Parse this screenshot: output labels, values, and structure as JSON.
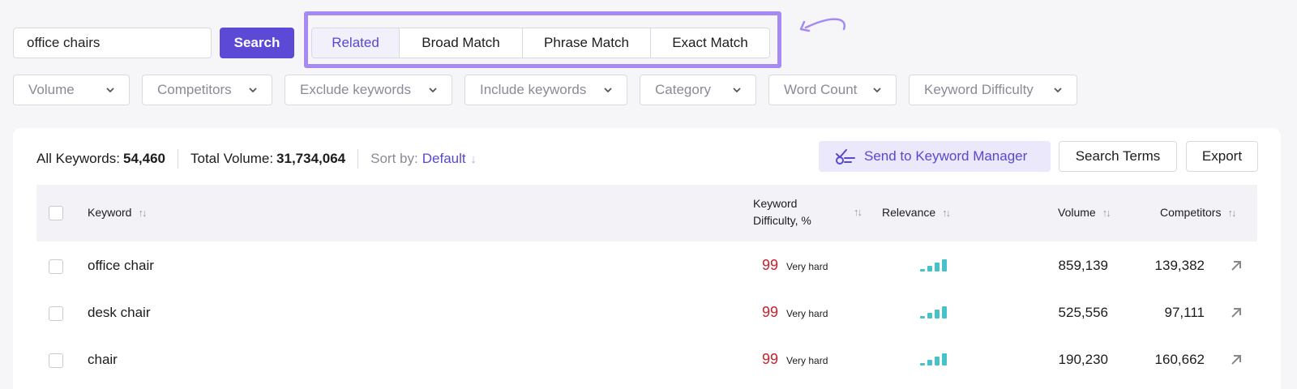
{
  "search": {
    "value": "office chairs",
    "button_label": "Search"
  },
  "match_tabs": [
    {
      "label": "Related",
      "active": true
    },
    {
      "label": "Broad Match",
      "active": false
    },
    {
      "label": "Phrase Match",
      "active": false
    },
    {
      "label": "Exact Match",
      "active": false
    }
  ],
  "filters": [
    "Volume",
    "Competitors",
    "Exclude keywords",
    "Include keywords",
    "Category",
    "Word Count",
    "Keyword Difficulty"
  ],
  "stats": {
    "all_keywords_label": "All Keywords:",
    "all_keywords_value": "54,460",
    "total_volume_label": "Total Volume:",
    "total_volume_value": "31,734,064",
    "sort_label": "Sort by:",
    "sort_value": "Default"
  },
  "actions": {
    "keyword_manager": "Send to Keyword Manager",
    "search_terms": "Search Terms",
    "export": "Export"
  },
  "table": {
    "columns": {
      "keyword": "Keyword",
      "kd_line1": "Keyword",
      "kd_line2": "Difficulty, %",
      "relevance": "Relevance",
      "volume": "Volume",
      "competitors": "Competitors"
    },
    "rows": [
      {
        "keyword": "office chair",
        "kd": "99",
        "kd_label": "Very hard",
        "relevance_bars": 4,
        "volume": "859,139",
        "competitors": "139,382"
      },
      {
        "keyword": "desk chair",
        "kd": "99",
        "kd_label": "Very hard",
        "relevance_bars": 4,
        "volume": "525,556",
        "competitors": "97,111"
      },
      {
        "keyword": "chair",
        "kd": "99",
        "kd_label": "Very hard",
        "relevance_bars": 4,
        "volume": "190,230",
        "competitors": "160,662"
      }
    ]
  },
  "colors": {
    "primary": "#5c4ad6",
    "highlight": "#a58af5",
    "difficulty_red": "#c8202c",
    "relevance_teal": "#48c2c9"
  },
  "icons": {
    "sort": "sort-arrows-icon",
    "chevron": "chevron-down-icon",
    "external": "arrow-up-right-icon",
    "keyword_manager": "keyword-manager-icon",
    "annotation": "curved-arrow-icon"
  }
}
